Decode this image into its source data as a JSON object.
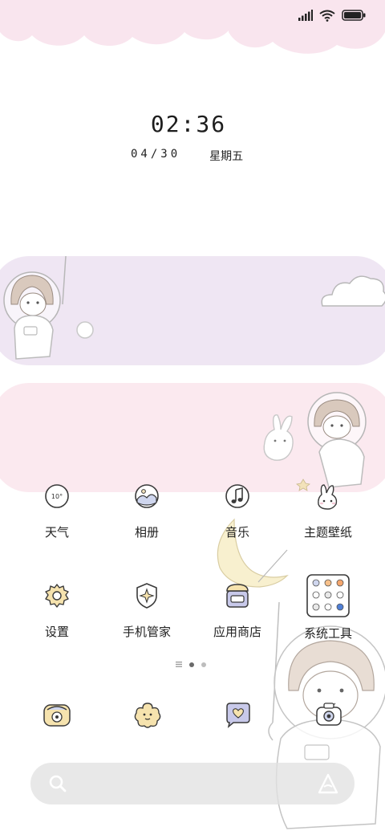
{
  "status_bar": {
    "icons": [
      "signal-icon",
      "wifi-icon",
      "battery-icon"
    ]
  },
  "lock": {
    "time": "02:36",
    "date": "04/30",
    "weekday": "星期五"
  },
  "apps": [
    {
      "label": "天气",
      "icon": "weather-icon",
      "icon_text": "10°"
    },
    {
      "label": "相册",
      "icon": "gallery-icon"
    },
    {
      "label": "音乐",
      "icon": "music-icon"
    },
    {
      "label": "主题壁纸",
      "icon": "theme-bunny-icon"
    },
    {
      "label": "设置",
      "icon": "settings-gear-icon"
    },
    {
      "label": "手机管家",
      "icon": "security-shield-icon"
    },
    {
      "label": "应用商店",
      "icon": "app-store-icon"
    },
    {
      "label": "系统工具",
      "icon": "system-tools-folder-icon"
    }
  ],
  "page_indicator": {
    "pages": 2,
    "active_index": 0
  },
  "dock": [
    {
      "icon": "phone-icon"
    },
    {
      "icon": "browser-flower-icon"
    },
    {
      "icon": "messages-heart-icon"
    },
    {
      "icon": "camera-icon"
    }
  ],
  "search_bar": {
    "icons": [
      "search-icon",
      "assistant-icon"
    ]
  },
  "colors": {
    "widget_top": "#efe6f3",
    "widget_bottom": "#fbe9ef",
    "cloud": "#f9e5ee",
    "icon_stroke": "#3a3a3a"
  }
}
